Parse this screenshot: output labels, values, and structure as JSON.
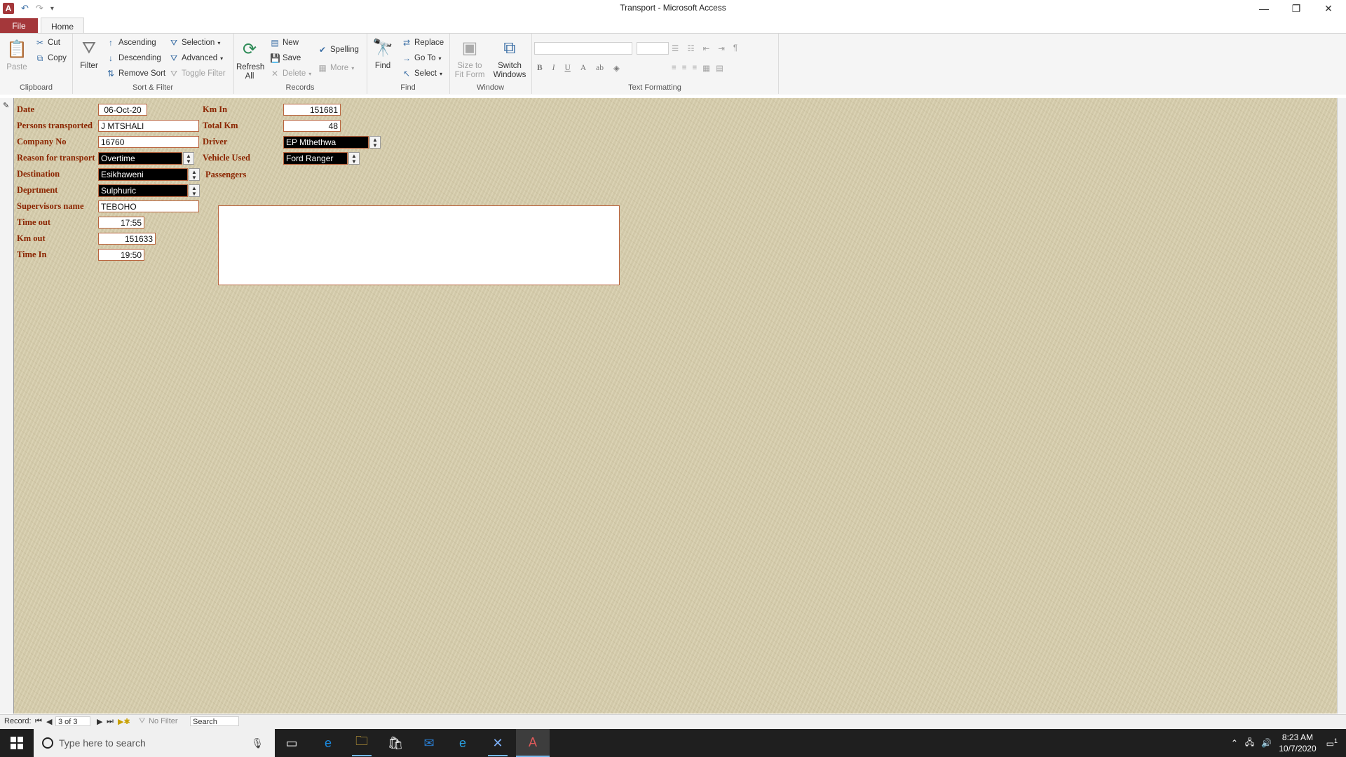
{
  "window": {
    "title": "Transport  -  Microsoft Access",
    "app_icon_letter": "A",
    "controls": {
      "minimize": "—",
      "restore": "❐",
      "close": "✕"
    }
  },
  "ribbon_tabs": {
    "file": "File",
    "home": "Home"
  },
  "ribbon": {
    "clipboard": {
      "label": "Clipboard",
      "paste": "Paste",
      "cut": "Cut",
      "copy": "Copy"
    },
    "sort_filter": {
      "label": "Sort & Filter",
      "filter": "Filter",
      "ascending": "Ascending",
      "descending": "Descending",
      "remove_sort": "Remove Sort",
      "selection": "Selection",
      "advanced": "Advanced",
      "toggle_filter": "Toggle Filter"
    },
    "records": {
      "label": "Records",
      "refresh_all_1": "Refresh",
      "refresh_all_2": "All",
      "new": "New",
      "save": "Save",
      "delete": "Delete",
      "spelling": "Spelling",
      "more": "More"
    },
    "find": {
      "label": "Find",
      "find": "Find",
      "replace": "Replace",
      "go_to": "Go To",
      "select": "Select"
    },
    "window": {
      "label": "Window",
      "size_fit_1": "Size to",
      "size_fit_2": "Fit Form",
      "switch_1": "Switch",
      "switch_2": "Windows"
    },
    "text_formatting": {
      "label": "Text Formatting",
      "bold": "B",
      "italic": "I",
      "underline": "U"
    }
  },
  "form": {
    "labels": {
      "date": "Date",
      "persons": "Persons  transported",
      "company_no": "Company No",
      "reason": "Reason for transport",
      "destination": "Destination",
      "department": "Deprtment",
      "supervisor": "Supervisors name",
      "time_out": "Time out",
      "km_out": "Km out",
      "time_in": "Time In",
      "km_in": "Km In",
      "total_km": "Total Km",
      "driver": "Driver",
      "vehicle": "Vehicle Used",
      "passengers": "Passengers"
    },
    "values": {
      "date": "06-Oct-20",
      "persons": "J MTSHALI",
      "company_no": "16760",
      "reason": "Overtime",
      "destination": "Esikhaweni",
      "department": "Sulphuric",
      "supervisor": "TEBOHO",
      "time_out": "17:55",
      "km_out": "151633",
      "time_in": "19:50",
      "km_in": "151681",
      "total_km": "48",
      "driver": "EP Mthethwa",
      "vehicle": "Ford Ranger",
      "passengers": ""
    }
  },
  "navbar": {
    "record_label": "Record:",
    "current": "3 of 3",
    "no_filter": "No Filter",
    "search": "Search"
  },
  "taskbar": {
    "search_placeholder": "Type here to search",
    "time": "8:23 AM",
    "date": "10/7/2020",
    "notifications": "1"
  }
}
